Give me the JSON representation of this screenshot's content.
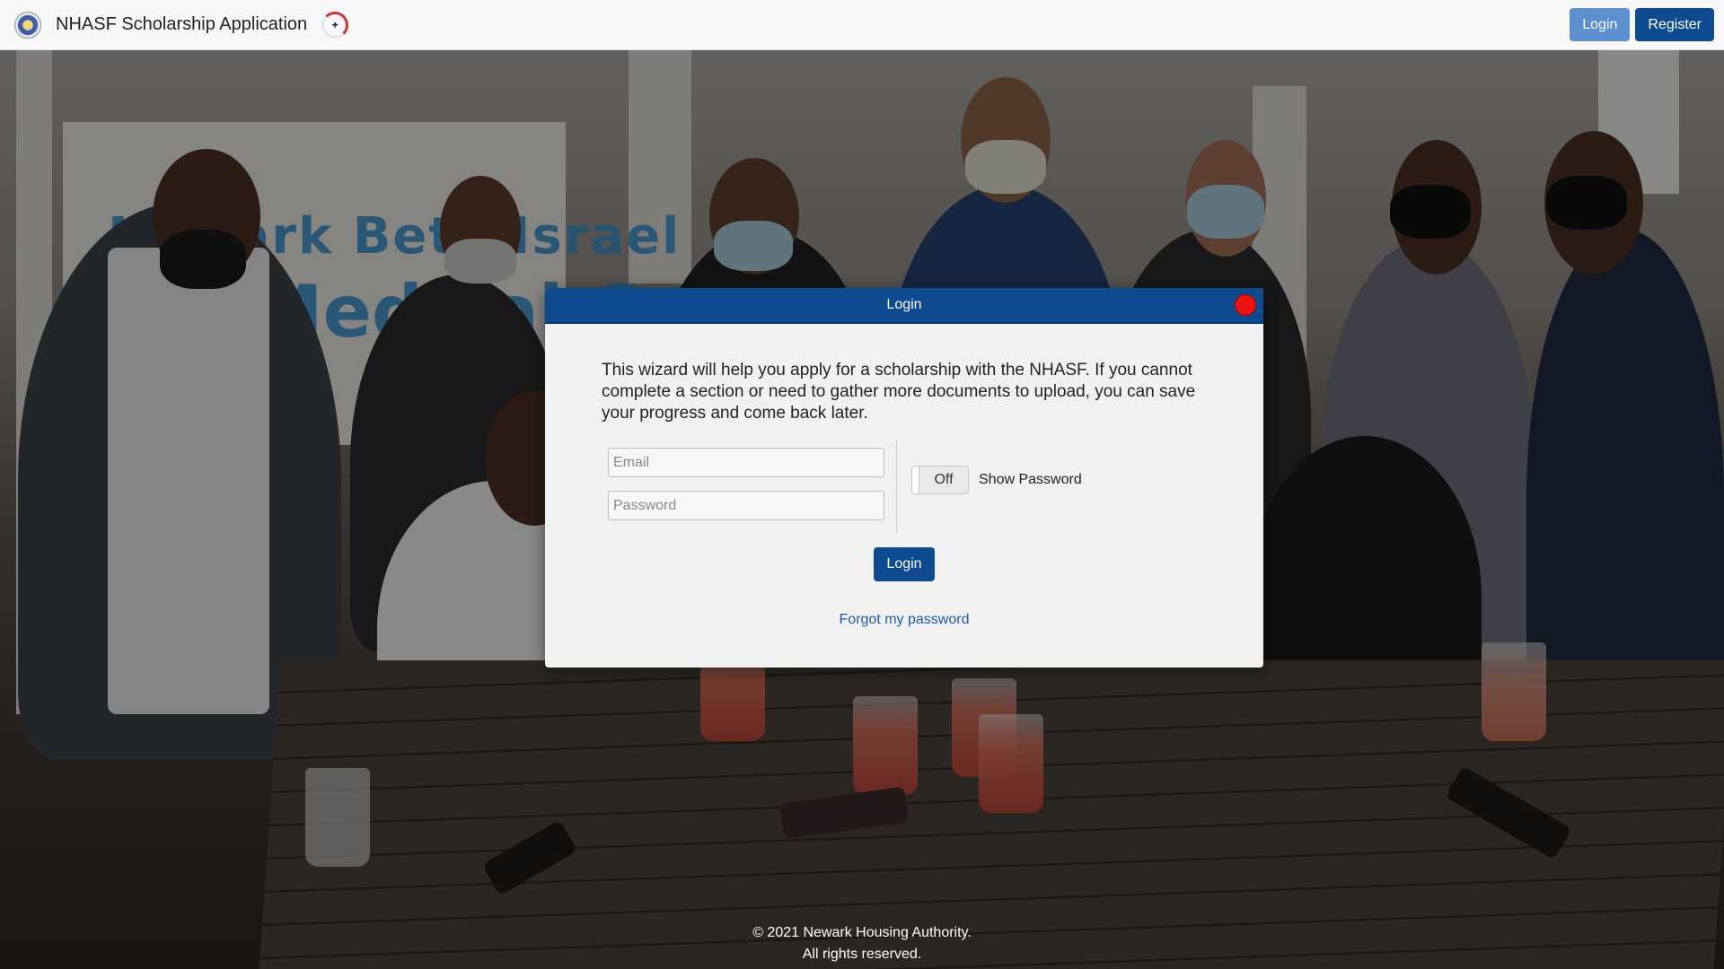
{
  "header": {
    "title": "NHASF Scholarship Application",
    "logo_icon": "housing-authority-logo-icon",
    "seal_icon": "nhasf-seal-icon",
    "login_label": "Login",
    "register_label": "Register"
  },
  "modal": {
    "title": "Login",
    "close_icon": "close-circle-icon",
    "intro": "This wizard will help you apply for a scholarship with the NHASF. If you cannot complete a section or need to gather more documents to upload, you can save your progress and come back later.",
    "email_placeholder": "Email",
    "email_value": "",
    "password_placeholder": "Password",
    "password_value": "",
    "toggle_state": "Off",
    "show_password_label": "Show Password",
    "submit_label": "Login",
    "forgot_label": "Forgot my password"
  },
  "footer": {
    "line1": "© 2021 Newark Housing Authority.",
    "line2": "All rights reserved."
  },
  "colors": {
    "primary": "#0e4a8f",
    "nav_login": "#5b8fd0",
    "close": "#ee1111",
    "link": "#1d5aa8"
  }
}
